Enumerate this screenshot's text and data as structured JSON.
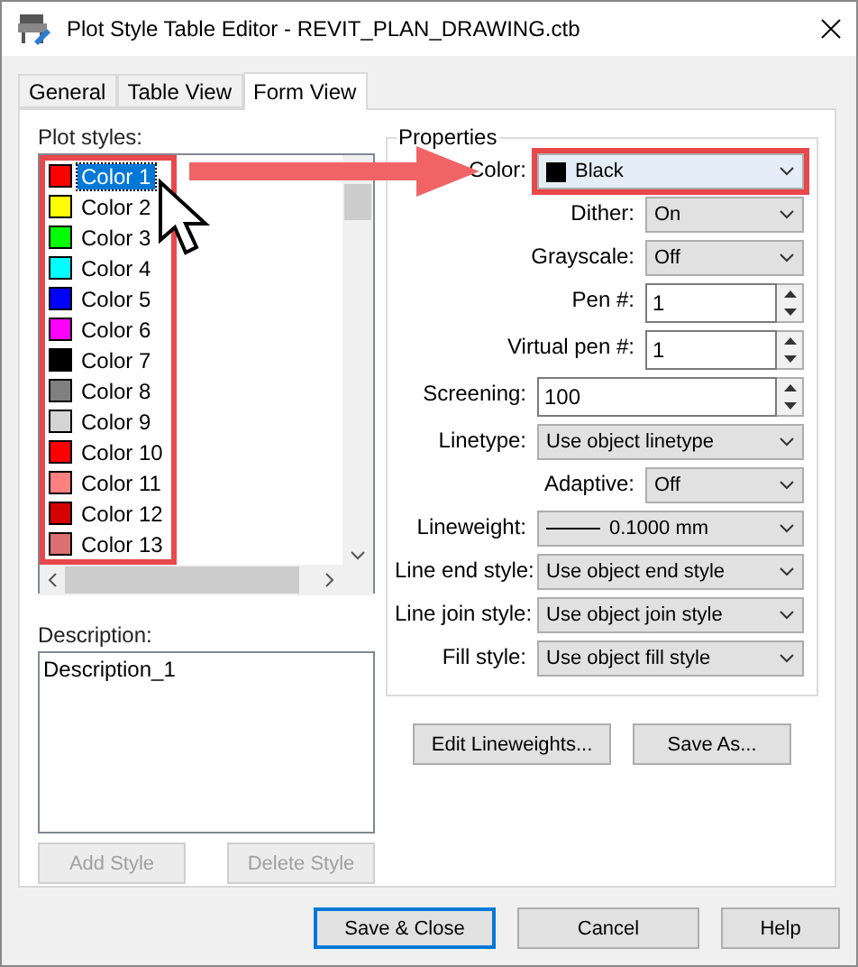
{
  "window": {
    "title": "Plot Style Table Editor - REVIT_PLAN_DRAWING.ctb"
  },
  "tabs": [
    {
      "label": "General",
      "selected": false
    },
    {
      "label": "Table View",
      "selected": false
    },
    {
      "label": "Form View",
      "selected": true
    }
  ],
  "plot_styles": {
    "label": "Plot styles:",
    "highlighted": true,
    "items": [
      {
        "name": "Color 1",
        "color": "#ff0000",
        "selected": true
      },
      {
        "name": "Color 2",
        "color": "#ffff00",
        "selected": false
      },
      {
        "name": "Color 3",
        "color": "#00ff00",
        "selected": false
      },
      {
        "name": "Color 4",
        "color": "#00ffff",
        "selected": false
      },
      {
        "name": "Color 5",
        "color": "#0000ff",
        "selected": false
      },
      {
        "name": "Color 6",
        "color": "#ff00ff",
        "selected": false
      },
      {
        "name": "Color 7",
        "color": "#000000",
        "selected": false
      },
      {
        "name": "Color 8",
        "color": "#808080",
        "selected": false
      },
      {
        "name": "Color 9",
        "color": "#d4d4d4",
        "selected": false
      },
      {
        "name": "Color 10",
        "color": "#ff0000",
        "selected": false
      },
      {
        "name": "Color 11",
        "color": "#ff8080",
        "selected": false
      },
      {
        "name": "Color 12",
        "color": "#d40000",
        "selected": false
      },
      {
        "name": "Color 13",
        "color": "#dd7070",
        "selected": false
      }
    ]
  },
  "description": {
    "label": "Description:",
    "value": "Description_1"
  },
  "style_buttons": [
    {
      "label": "Add Style",
      "disabled": true
    },
    {
      "label": "Delete Style",
      "disabled": true
    }
  ],
  "properties": {
    "title": "Properties",
    "rows": [
      {
        "kind": "combo",
        "label": "Color:",
        "value": "Black",
        "color": "#000000",
        "highlighted": true
      },
      {
        "kind": "option",
        "label": "Dither:",
        "value": "On",
        "highlighted": false
      },
      {
        "kind": "option",
        "label": "Grayscale:",
        "value": "Off",
        "highlighted": false
      },
      {
        "kind": "pen",
        "label": "Pen #:",
        "value": "1",
        "highlighted": false
      },
      {
        "kind": "pen",
        "label": "Virtual pen #:",
        "value": "1",
        "highlighted": false
      },
      {
        "kind": "number",
        "label": "Screening:",
        "value": "100",
        "highlighted": false
      },
      {
        "kind": "combo",
        "label": "Linetype:",
        "value": "Use object linetype",
        "highlighted": false
      },
      {
        "kind": "option",
        "label": "Adaptive:",
        "value": "Off",
        "highlighted": false
      },
      {
        "kind": "weight",
        "label": "Lineweight:",
        "value": "0.1000 mm",
        "highlighted": false
      },
      {
        "kind": "combo",
        "label": "Line end style:",
        "value": "Use object end style",
        "highlighted": false
      },
      {
        "kind": "combo",
        "label": "Line join style:",
        "value": "Use object join style",
        "highlighted": false
      },
      {
        "kind": "combo",
        "label": "Fill style:",
        "value": "Use object fill style",
        "highlighted": false
      }
    ]
  },
  "property_buttons": [
    "Edit Lineweights...",
    "Save As..."
  ],
  "dialog_buttons": [
    {
      "label": "Save & Close",
      "default": true
    },
    {
      "label": "Cancel",
      "default": false
    },
    {
      "label": "Help",
      "default": false
    }
  ]
}
